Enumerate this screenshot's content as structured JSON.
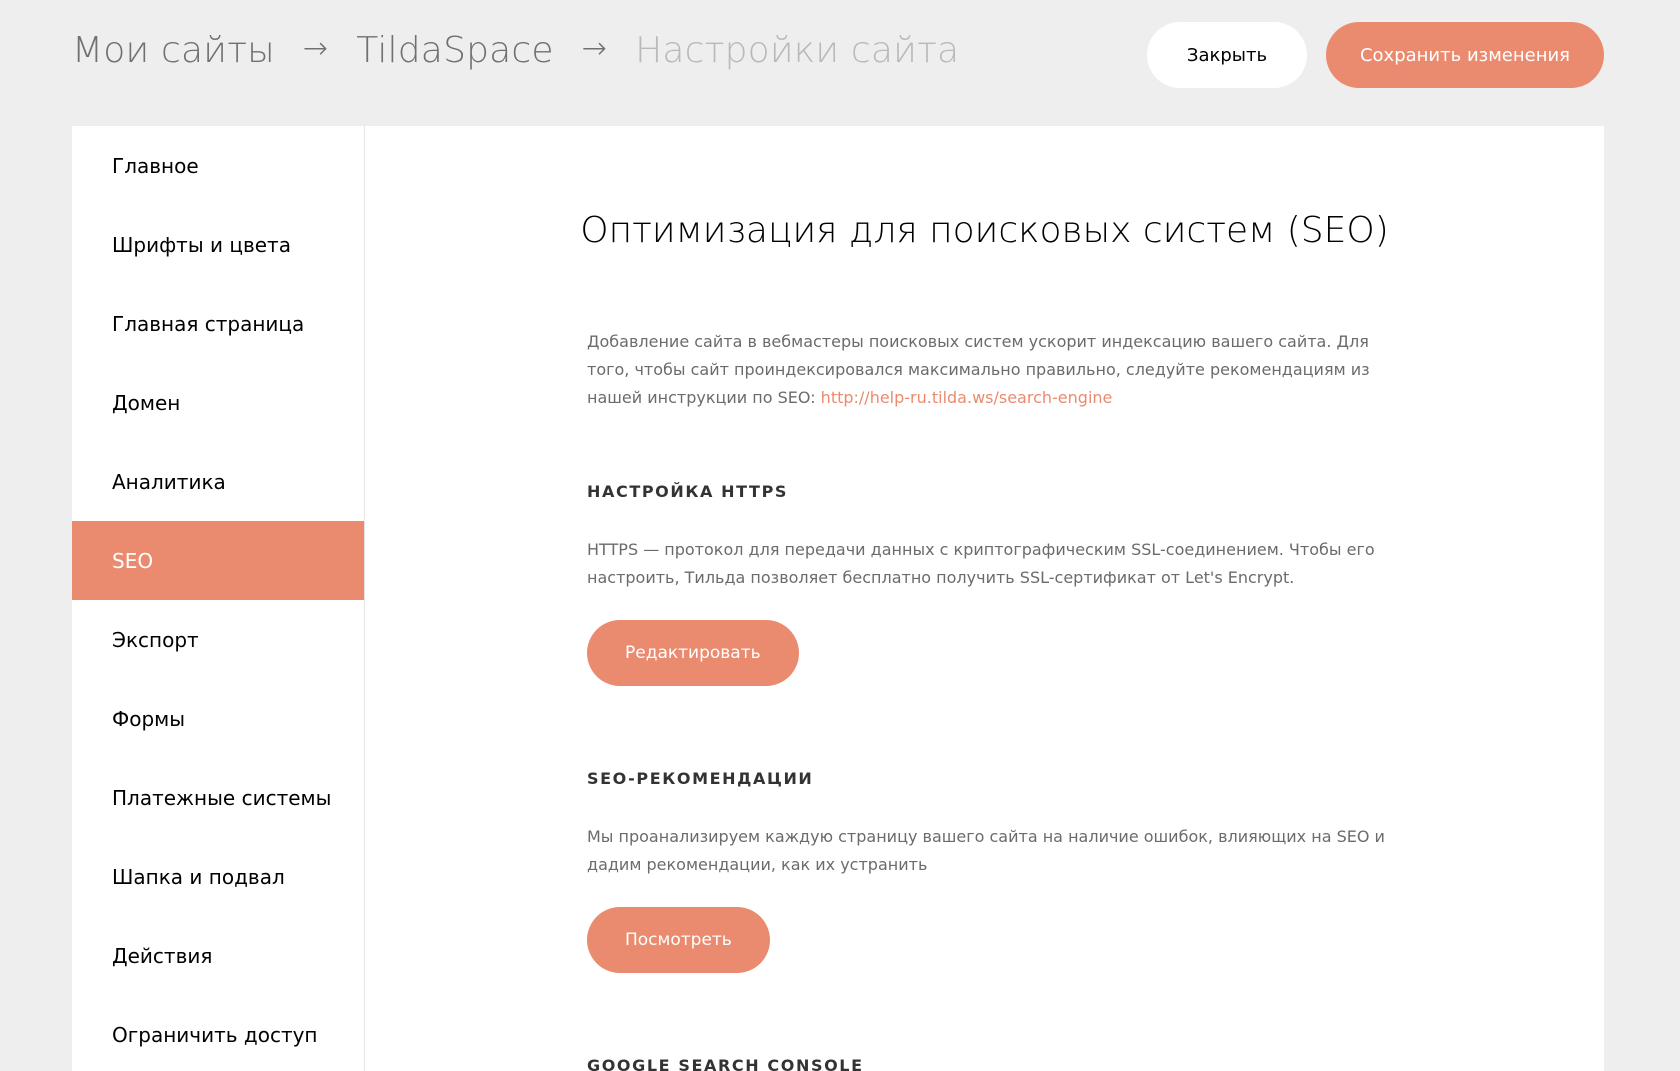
{
  "header": {
    "breadcrumb": {
      "item1": "Мои сайты",
      "item2": "TildaSpace",
      "item3": "Настройки сайта",
      "separator": "→"
    },
    "close_label": "Закрыть",
    "save_label": "Сохранить изменения"
  },
  "sidebar": {
    "items": [
      {
        "label": "Главное"
      },
      {
        "label": "Шрифты и цвета"
      },
      {
        "label": "Главная страница"
      },
      {
        "label": "Домен"
      },
      {
        "label": "Аналитика"
      },
      {
        "label": "SEO"
      },
      {
        "label": "Экспорт"
      },
      {
        "label": "Формы"
      },
      {
        "label": "Платежные системы"
      },
      {
        "label": "Шапка и подвал"
      },
      {
        "label": "Действия"
      },
      {
        "label": "Ограничить доступ"
      }
    ],
    "active_item": "SEO"
  },
  "main": {
    "title": "Оптимизация для поисковых систем (SEO)",
    "intro": {
      "text": "Добавление сайта в вебмастеры поисковых систем ускорит индексацию вашего сайта. Для того, чтобы сайт проиндексировался максимально правильно, следуйте рекомендациям из нашей инструкции по SEO: ",
      "link": "http://help-ru.tilda.ws/search-engine"
    },
    "https": {
      "heading": "НАСТРОЙКА HTTPS",
      "text": "HTTPS — протокол для передачи данных с криптографическим SSL-соединением. Чтобы его настроить, Тильда позволяет бесплатно получить SSL-сертификат от Let's Encrypt.",
      "button": "Редактировать"
    },
    "seo_recommendations": {
      "heading": "SEO-РЕКОМЕНДАЦИИ",
      "text": "Мы проанализируем каждую страницу вашего сайта на наличие ошибок, влияющих на SEO и дадим рекомендации, как их устранить",
      "button": "Посмотреть"
    },
    "google_search_console": {
      "heading": "GOOGLE SEARCH CONSOLE"
    }
  },
  "colors": {
    "accent": "#ea8b6f",
    "background": "#eeeeee",
    "panel": "#ffffff"
  }
}
